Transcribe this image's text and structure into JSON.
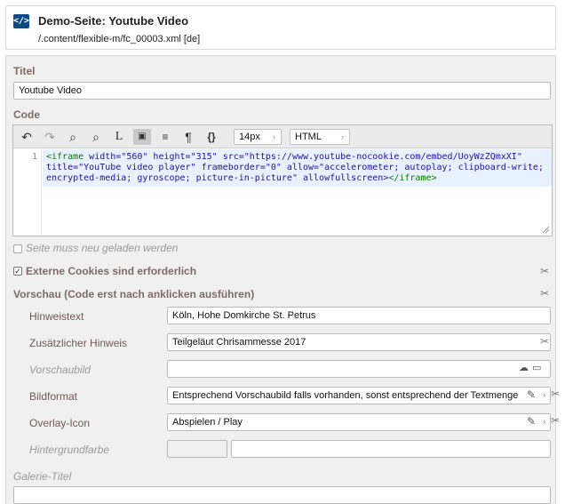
{
  "header": {
    "logo_text": "</>",
    "title": "Demo-Seite: Youtube Video",
    "path": "/.content/flexible-m/fc_00003.xml [de]"
  },
  "fields": {
    "titel_label": "Titel",
    "titel_value": "Youtube Video",
    "code_label": "Code",
    "reload_label": "Seite muss neu geladen werden",
    "cookies_label": "Externe Cookies sind erforderlich",
    "vorschau_label": "Vorschau (Code erst nach anklicken ausführen)",
    "hinweistext_label": "Hinweistext",
    "hinweistext_value": "Köln, Hohe Domkirche St. Petrus",
    "zusatz_label": "Zusätzlicher Hinweis",
    "zusatz_value": "Teilgeläut Chrisammesse 2017",
    "vorschaubild_label": "Vorschaubild",
    "vorschaubild_value": "",
    "bildformat_label": "Bildformat",
    "bildformat_value": "Entsprechend Vorschaubild falls vorhanden, sonst entsprechend der Textmenge",
    "overlay_label": "Overlay-Icon",
    "overlay_value": "Abspielen / Play",
    "hintergrund_label": "Hintergrundfarbe",
    "galerie_label": "Galerie-Titel",
    "galerie_value": ""
  },
  "editor": {
    "font_size": "14px",
    "mode": "HTML",
    "line_number": "1",
    "code_line1_tag": "<iframe",
    "code_line1_rest": " width=\"560\" height=\"315\" src=\"https://www.youtube-nocookie.com/embed/UoyWzZQmxXI\"",
    "code_line2": "title=\"YouTube video player\" frameborder=\"0\" allow=\"accelerometer; autoplay; clipboard-write;",
    "code_line3_a": "encrypted-media; gyroscope; picture-in-picture\" allowfullscreen>",
    "code_line3_tag": "</iframe>",
    "toolbar_icons": [
      "undo-icon",
      "redo-icon",
      "search-icon",
      "search-replace-icon",
      "goto-line-icon",
      "html-mode-icon",
      "wrap-icon",
      "paragraph-icon",
      "braces-icon"
    ]
  },
  "checkboxes": {
    "reload_checked": false,
    "cookies_checked": true
  },
  "colors": {
    "accent": "#0b4a82",
    "label": "#7f6b66",
    "panel_bg": "#f0f0f0",
    "code_highlight": "#e8f2ff"
  }
}
